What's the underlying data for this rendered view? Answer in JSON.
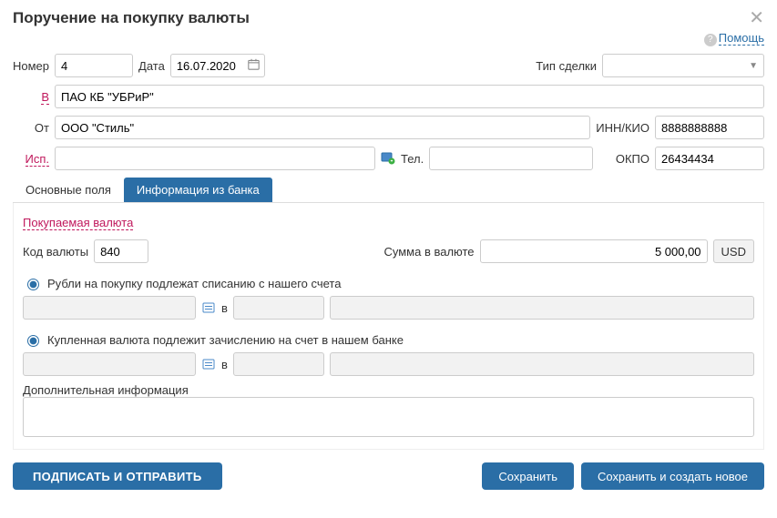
{
  "title": "Поручение на покупку валюты",
  "help": "Помощь",
  "labels": {
    "number": "Номер",
    "date": "Дата",
    "deal_type": "Тип сделки",
    "in": "В",
    "from": "От",
    "inn": "ИНН/КИО",
    "isp": "Исп.",
    "tel": "Тел.",
    "okpo": "ОКПО",
    "v": "в"
  },
  "values": {
    "number": "4",
    "date": "16.07.2020",
    "deal_type": "",
    "bank": "ПАО КБ \"УБРиР\"",
    "from": "ООО \"Стиль\"",
    "inn": "8888888888",
    "isp": "",
    "tel": "",
    "okpo": "26434434"
  },
  "tabs": {
    "main": "Основные поля",
    "bank_info": "Информация из банка"
  },
  "buy": {
    "section": "Покупаемая валюта",
    "code_label": "Код валюты",
    "code": "840",
    "amount_label": "Сумма в валюте",
    "amount": "5 000,00",
    "currency": "USD"
  },
  "radio1": "Рубли на покупку подлежат списанию с нашего счета",
  "radio2": "Купленная валюта подлежит зачислению на счет в нашем банке",
  "addinfo_label": "Дополнительная информация",
  "addinfo": "",
  "buttons": {
    "sign": "ПОДПИСАТЬ И ОТПРАВИТЬ",
    "save": "Сохранить",
    "save_new": "Сохранить и создать новое"
  }
}
